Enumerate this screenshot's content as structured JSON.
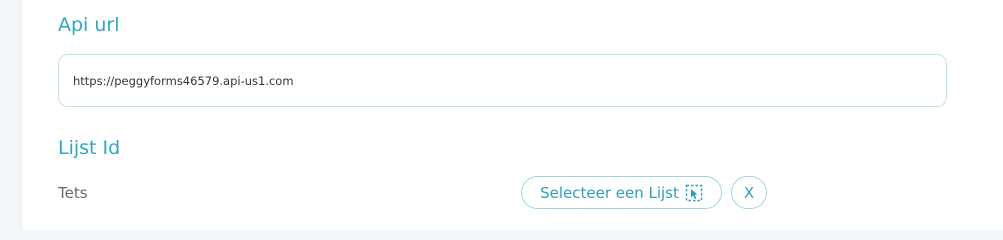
{
  "api_section": {
    "title": "Api url",
    "url_value": "https://peggyforms46579.api-us1.com"
  },
  "list_section": {
    "title": "Lijst Id",
    "selected_value": "Tets",
    "select_button_label": "Selecteer een Lijst",
    "select_button_icon": "selection-cursor-icon",
    "clear_button_label": "X"
  },
  "colors": {
    "accent": "#2fa7c2",
    "border": "#bfe4ea",
    "text_muted": "#6a6a6a"
  }
}
